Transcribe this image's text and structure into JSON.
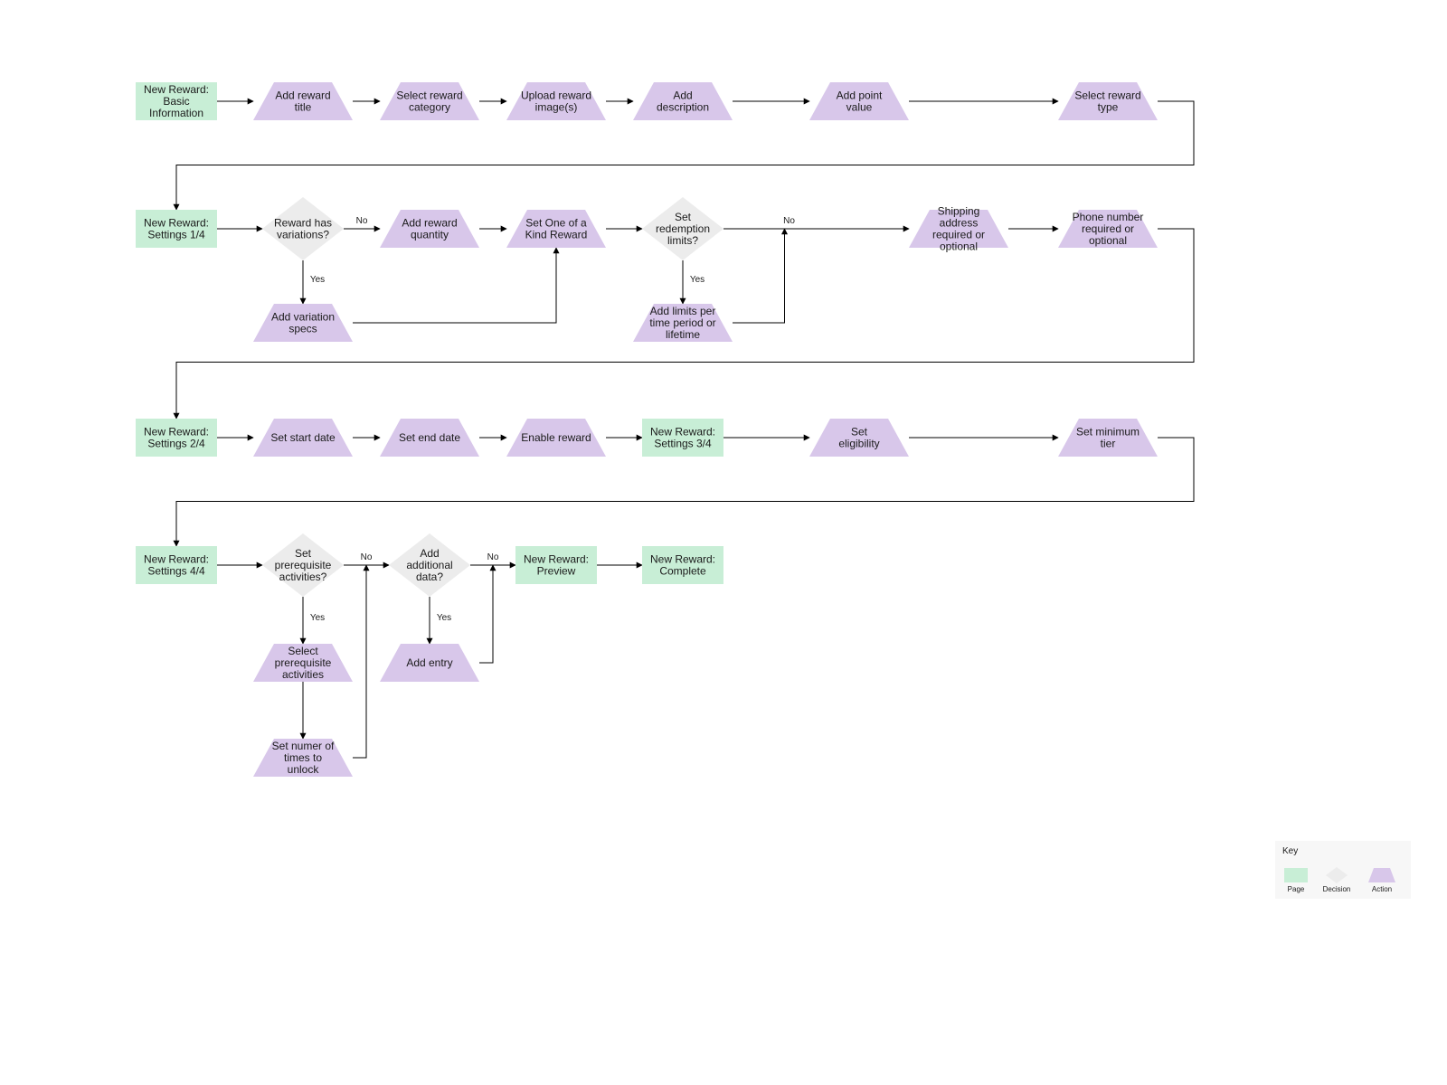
{
  "nodes": {
    "p_basic": {
      "type": "page",
      "label": "New Reward: Basic Information"
    },
    "a_title": {
      "type": "action",
      "label": "Add reward title"
    },
    "a_category": {
      "type": "action",
      "label": "Select reward category"
    },
    "a_images": {
      "type": "action",
      "label": "Upload reward image(s)"
    },
    "a_desc": {
      "type": "action",
      "label": "Add description"
    },
    "a_points": {
      "type": "action",
      "label": "Add point value"
    },
    "a_type": {
      "type": "action",
      "label": "Select reward type"
    },
    "p_set1": {
      "type": "page",
      "label": "New Reward: Settings 1/4"
    },
    "d_vars": {
      "type": "decision",
      "label": "Reward has variations?"
    },
    "a_qty": {
      "type": "action",
      "label": "Add reward quantity"
    },
    "a_one": {
      "type": "action",
      "label": "Set One of a Kind Reward"
    },
    "d_limits": {
      "type": "decision",
      "label": "Set redemption limits?"
    },
    "a_ship": {
      "type": "action",
      "label": "Shipping address required or optional"
    },
    "a_phone": {
      "type": "action",
      "label": "Phone number required or optional"
    },
    "a_varspec": {
      "type": "action",
      "label": "Add variation specs"
    },
    "a_limits": {
      "type": "action",
      "label": "Add limits per time period or lifetime"
    },
    "p_set2": {
      "type": "page",
      "label": "New Reward: Settings 2/4"
    },
    "a_start": {
      "type": "action",
      "label": "Set start date"
    },
    "a_end": {
      "type": "action",
      "label": "Set end date"
    },
    "a_enable": {
      "type": "action",
      "label": "Enable reward"
    },
    "p_set3": {
      "type": "page",
      "label": "New Reward: Settings 3/4"
    },
    "a_elig": {
      "type": "action",
      "label": "Set eligibility"
    },
    "a_tier": {
      "type": "action",
      "label": "Set minimum tier"
    },
    "p_set4": {
      "type": "page",
      "label": "New Reward: Settings 4/4"
    },
    "d_prereq": {
      "type": "decision",
      "label": "Set prerequisite activities?"
    },
    "d_adddata": {
      "type": "decision",
      "label": "Add additional data?"
    },
    "p_preview": {
      "type": "page",
      "label": "New Reward: Preview"
    },
    "p_complete": {
      "type": "page",
      "label": "New Reward: Complete"
    },
    "a_selpre": {
      "type": "action",
      "label": "Select prerequisite activities"
    },
    "a_unlock": {
      "type": "action",
      "label": "Set numer of times to unlock"
    },
    "a_entry": {
      "type": "action",
      "label": "Add entry"
    }
  },
  "edgeLabels": {
    "yes": "Yes",
    "no": "No"
  },
  "legend": {
    "title": "Key",
    "page": "Page",
    "decision": "Decision",
    "action": "Action"
  },
  "colors": {
    "page": "#c8eed6",
    "action": "#d8c7ea",
    "decision": "#ececec",
    "stroke": "#000000"
  }
}
